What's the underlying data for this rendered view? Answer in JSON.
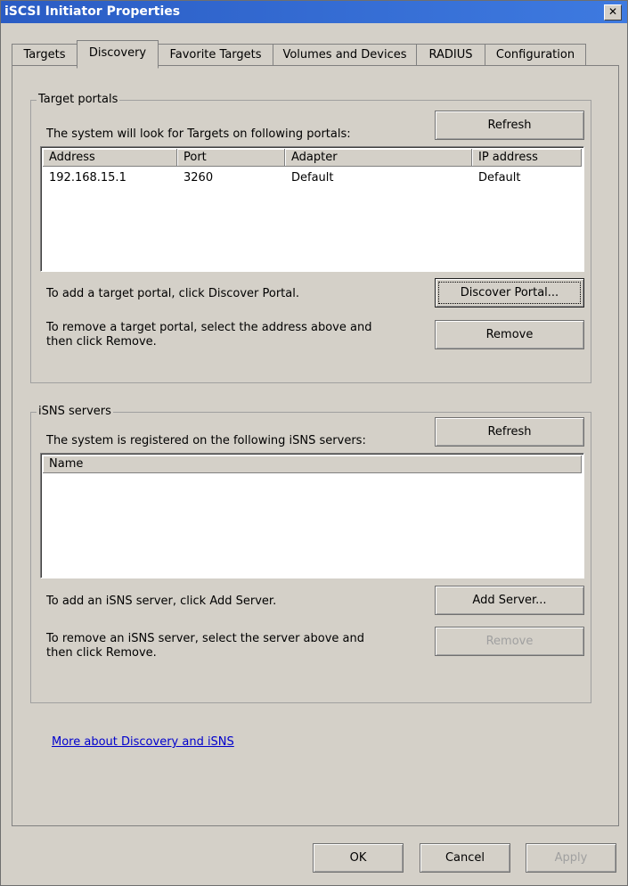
{
  "window": {
    "title": "iSCSI Initiator Properties",
    "close_glyph": "✕"
  },
  "tabs": [
    "Targets",
    "Discovery",
    "Favorite Targets",
    "Volumes and Devices",
    "RADIUS",
    "Configuration"
  ],
  "target_portals": {
    "group_title": "Target portals",
    "description": "The system will look for Targets on following portals:",
    "refresh_label": "Refresh",
    "columns": [
      "Address",
      "Port",
      "Adapter",
      "IP address"
    ],
    "rows": [
      {
        "address": "192.168.15.1",
        "port": "3260",
        "adapter": "Default",
        "ip": "Default"
      }
    ],
    "add_text": "To add a target portal, click Discover Portal.",
    "discover_label": "Discover Portal...",
    "remove_text_1": "To remove a target portal, select the address above and",
    "remove_text_2": "then click Remove.",
    "remove_label": "Remove"
  },
  "isns": {
    "group_title": "iSNS servers",
    "description": "The system is registered on the following iSNS servers:",
    "refresh_label": "Refresh",
    "columns": [
      "Name"
    ],
    "add_text": "To add an iSNS server, click Add Server.",
    "add_label": "Add Server...",
    "remove_text_1": "To remove an iSNS server, select the server above and",
    "remove_text_2": "then click Remove.",
    "remove_label": "Remove"
  },
  "link_text": "More about Discovery and iSNS",
  "footer": {
    "ok": "OK",
    "cancel": "Cancel",
    "apply": "Apply"
  }
}
